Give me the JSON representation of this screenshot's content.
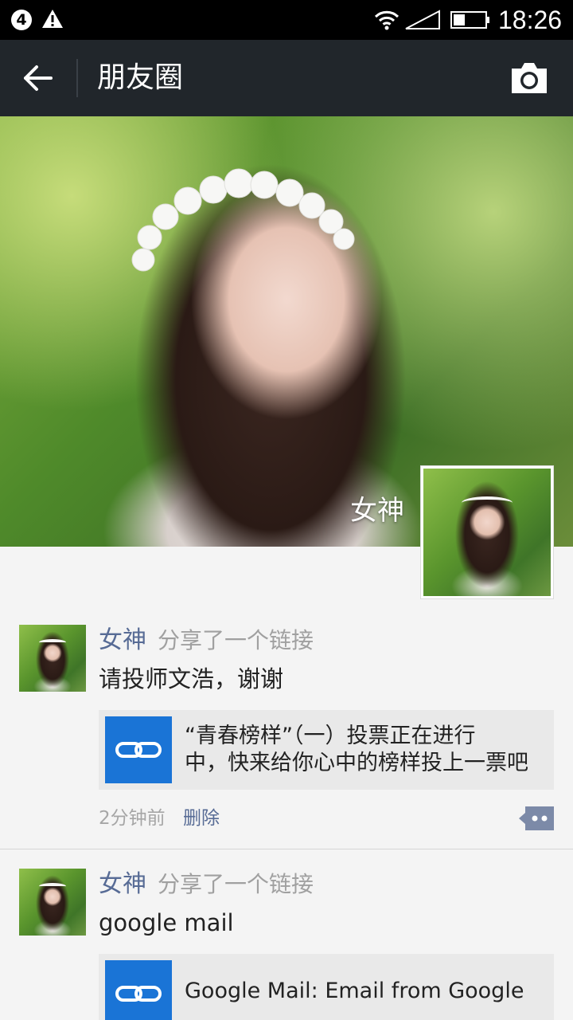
{
  "status_bar": {
    "notification_count": "4",
    "time": "18:26",
    "icons": [
      "warning-icon",
      "wifi-icon",
      "signal-icon",
      "battery-icon"
    ]
  },
  "header": {
    "title": "朋友圈",
    "back_icon": "arrow-left-icon",
    "camera_icon": "camera-icon"
  },
  "profile": {
    "name": "女神"
  },
  "posts": [
    {
      "author": "女神",
      "action": "分享了一个链接",
      "text": "请投师文浩，谢谢",
      "link_title_line1": "“青春榜样”（一）投票正在进行",
      "link_title_line2": "中，快来给你心中的榜样投上一票吧",
      "time": "2分钟前",
      "delete_label": "删除"
    },
    {
      "author": "女神",
      "action": "分享了一个链接",
      "text": "google mail",
      "link_title": "Google Mail: Email from Google"
    }
  ],
  "colors": {
    "title_bar": "#21262b",
    "name_link": "#576b95",
    "link_icon_bg": "#1a74d6",
    "feed_bg": "#f4f4f4"
  }
}
